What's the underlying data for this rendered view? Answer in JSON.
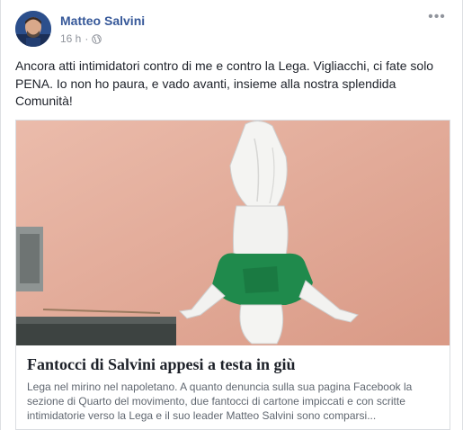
{
  "post": {
    "author": "Matteo Salvini",
    "time": "16 h",
    "separator": "·",
    "privacy_icon": "globe-icon",
    "more_icon": "more-options-icon",
    "more_glyph": "•••",
    "text": "Ancora atti intimidatori contro di me e contro la Lega. Vigliacchi, ci fate solo PENA. Io non ho paura, e vado avanti, insieme alla nostra splendida Comunità!"
  },
  "link": {
    "title": "Fantocci di Salvini appesi a testa in giù",
    "description": "Lega nel mirino nel napoletano. A quanto denuncia sulla sua pagina Facebook la sezione di Quarto del movimento, due fantocci di cartone impiccati e con scritte intimidatorie verso la Lega e il suo leader Matteo Salvini sono comparsi..."
  },
  "colors": {
    "author_link": "#365899",
    "meta": "#90949c",
    "wall": "#e7a993",
    "shirt": "#1f8a4c"
  }
}
